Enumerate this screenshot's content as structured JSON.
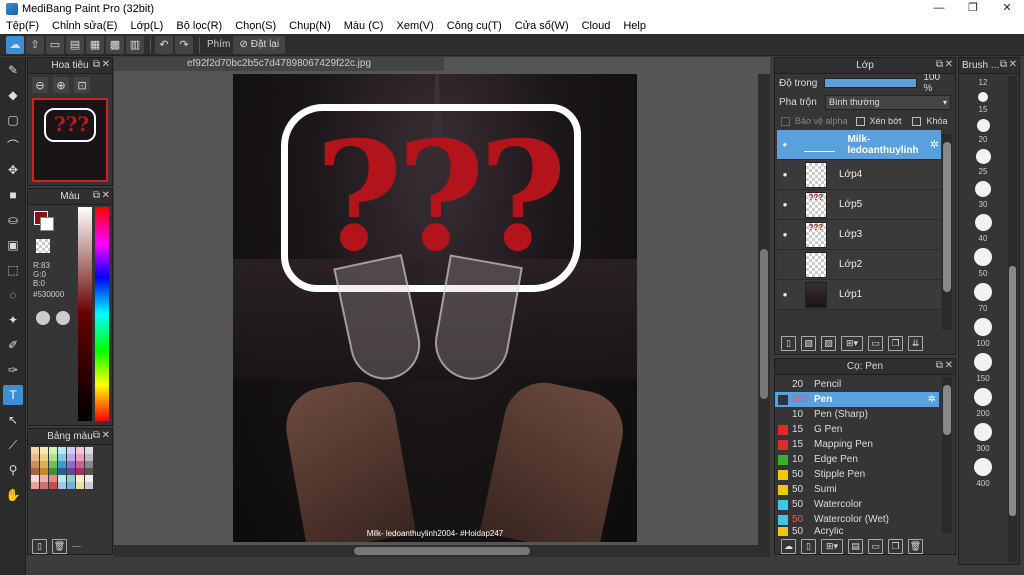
{
  "window": {
    "title": "MediBang Paint Pro (32bit)",
    "minimize": "—",
    "maximize": "❐",
    "close": "✕"
  },
  "menu": [
    "Tệp(F)",
    "Chỉnh sửa(E)",
    "Lớp(L)",
    "Bộ lọc(R)",
    "Chọn(S)",
    "Chụp(N)",
    "Màu (C)",
    "Xem(V)",
    "Công cụ(T)",
    "Cửa sổ(W)",
    "Cloud",
    "Help"
  ],
  "toolbar": {
    "key_label": "Phím",
    "reset_label": "Đặt lại"
  },
  "navigator": {
    "title": "Hoa tiêu"
  },
  "color": {
    "title": "Màu",
    "r": "R:83",
    "g": "G:0",
    "b": "B:0",
    "hex": "#530000",
    "primary": "#8a0f0f"
  },
  "palette": {
    "title": "Bảng màu",
    "footer": "---"
  },
  "document": {
    "tab": "ef92f2d70bc2b5c7d47898067429f22c.jpg",
    "watermark": "Milk- ledoanthuylinh2004- #Hoidap247"
  },
  "layers": {
    "title": "Lớp",
    "opacity_label": "Độ trong",
    "opacity_value": "100 %",
    "blend_label": "Pha trộn",
    "blend_value": "Bình thường",
    "protect_alpha": "Bảo vệ alpha",
    "clip": "Xén bớt",
    "lock": "Khóa",
    "items": [
      {
        "name": "Milk- ledoanthuylinh",
        "selected": true,
        "visible": true
      },
      {
        "name": "Lớp4",
        "selected": false,
        "visible": true
      },
      {
        "name": "Lớp5",
        "selected": false,
        "visible": true
      },
      {
        "name": "Lớp3",
        "selected": false,
        "visible": true
      },
      {
        "name": "Lớp2",
        "selected": false,
        "visible": false
      },
      {
        "name": "Lớp1",
        "selected": false,
        "visible": true
      }
    ]
  },
  "brushes": {
    "title": "Cọ: Pen",
    "items": [
      {
        "size": "20",
        "name": "Pencil",
        "color": "#333333"
      },
      {
        "size": "500",
        "name": "Pen",
        "color": "#2a3440",
        "selected": true
      },
      {
        "size": "10",
        "name": "Pen (Sharp)",
        "color": "#333333"
      },
      {
        "size": "15",
        "name": "G Pen",
        "color": "#e02b2b"
      },
      {
        "size": "15",
        "name": "Mapping Pen",
        "color": "#e02b2b"
      },
      {
        "size": "10",
        "name": "Edge Pen",
        "color": "#3bb02f"
      },
      {
        "size": "50",
        "name": "Stipple Pen",
        "color": "#f0c808"
      },
      {
        "size": "50",
        "name": "Sumi",
        "color": "#f0c808"
      },
      {
        "size": "50",
        "name": "Watercolor",
        "color": "#3cc6e8"
      },
      {
        "size": "50",
        "name": "Watercolor (Wet)",
        "color": "#3cc6e8"
      },
      {
        "size": "50",
        "name": "Acrylic",
        "color": "#f0c808"
      }
    ]
  },
  "brush_size": {
    "title": "Brush ...",
    "sizes": [
      "12",
      "15",
      "20",
      "25",
      "30",
      "40",
      "50",
      "70",
      "100",
      "150",
      "200",
      "300",
      "400"
    ]
  }
}
